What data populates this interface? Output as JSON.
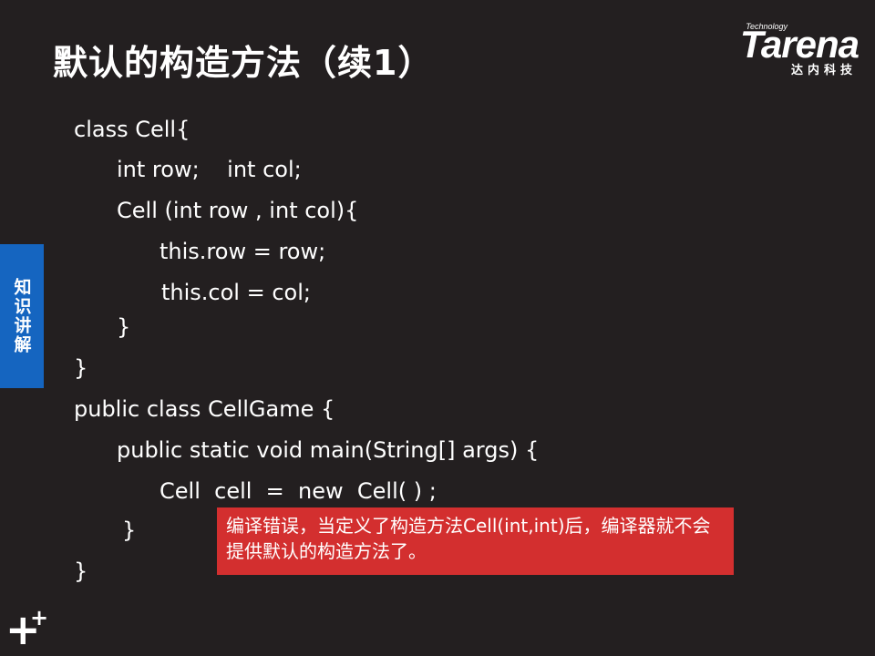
{
  "slide": {
    "title": "默认的构造方法（续1）",
    "side_tab": "知识讲解"
  },
  "logo": {
    "tagline": "Technology",
    "word": "Tarena",
    "sub": "达内科技"
  },
  "code": [
    "class Cell{",
    "int row;    int col;",
    "Cell (int row , int col){",
    "this.row = row;",
    "this.col = col;",
    "}",
    "}",
    "public class CellGame {",
    "public static void main(String[] args) {",
    "Cell  cell  =  new  Cell( ) ;",
    "}",
    "}"
  ],
  "callout": {
    "text": "编译错误，当定义了构造方法Cell(int,int)后，编译器就不会提供默认的构造方法了。"
  },
  "colors": {
    "background": "#231f20",
    "side_tab": "#1565c0",
    "callout": "#d32f2f"
  }
}
